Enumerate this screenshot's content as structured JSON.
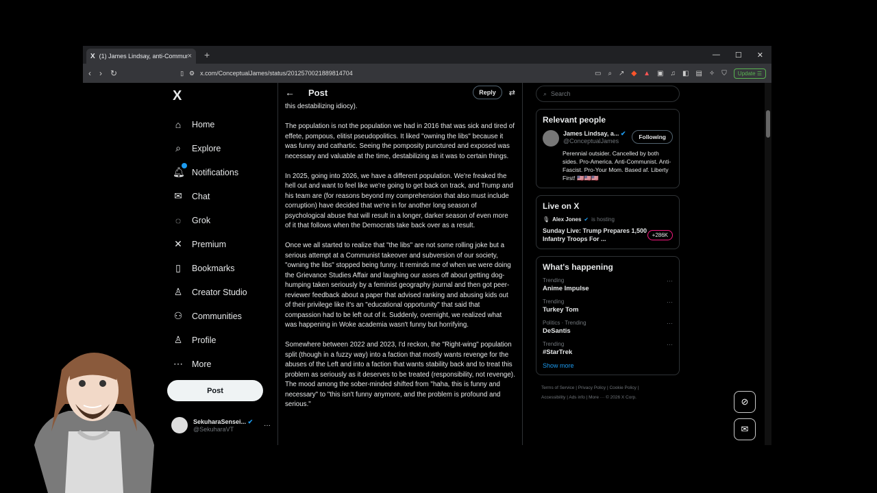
{
  "browser": {
    "tab_title": "(1) James Lindsay, anti-Commun",
    "url": "x.com/ConceptualJames/status/2012570021889814704",
    "update_label": "Update"
  },
  "nav": {
    "logo": "X",
    "items": [
      {
        "label": "Home",
        "icon": "⌂"
      },
      {
        "label": "Explore",
        "icon": "⌕"
      },
      {
        "label": "Notifications",
        "icon": "♫"
      },
      {
        "label": "Chat",
        "icon": "✉"
      },
      {
        "label": "Grok",
        "icon": "◌"
      },
      {
        "label": "Premium",
        "icon": "✕"
      },
      {
        "label": "Bookmarks",
        "icon": "▯"
      },
      {
        "label": "Creator Studio",
        "icon": "♙"
      },
      {
        "label": "Communities",
        "icon": "⚇"
      },
      {
        "label": "Profile",
        "icon": "♙"
      },
      {
        "label": "More",
        "icon": "⋯"
      }
    ],
    "post_label": "Post"
  },
  "account": {
    "name": "SekuharaSensei...",
    "handle": "@SekuharaVT"
  },
  "header": {
    "title": "Post",
    "reply_label": "Reply"
  },
  "post": {
    "paragraphs": [
      "this destabilizing idiocy).",
      "The population is not the population we had in 2016 that was sick and tired of effete, pompous, elitist pseudopolitics. It liked \"owning the libs\" because it was funny and cathartic. Seeing the pomposity punctured and exposed was necessary and valuable at the time, destabilizing as it was to certain things.",
      "In 2025, going into 2026, we have a different population. We're freaked the hell out and want to feel like we're going to get back on track, and Trump and his team are (for reasons beyond my comprehension that also must include corruption) have decided that we're in for another long season of psychological abuse that will result in a longer, darker season of even more of it that follows when the Democrats take back over as a result.",
      "Once we all started to realize that \"the libs\" are not some rolling joke but a serious attempt at a Communist takeover and subversion of our society, \"owning the libs\" stopped being funny. It reminds me of when we were doing the Grievance Studies Affair and laughing our asses off about getting dog-humping taken seriously by a feminist geography journal and then got peer-reviewer feedback about a paper that advised ranking and abusing kids out of their privilege like it's an \"educational opportunity\" that said that compassion had to be left out of it. Suddenly, overnight, we realized what was happening in Woke academia wasn't funny but horrifying.",
      "Somewhere between 2022 and 2023, I'd reckon, the \"Right-wing\" population split (though in a fuzzy way) into a faction that mostly wants revenge for the abuses of the Left and into a faction that wants stability back and to treat this problem as seriously as it deserves to be treated (responsibility, not revenge). The mood among the sober-minded shifted from \"haha, this is funny and necessary\" to \"this isn't funny anymore, and the problem is profound and serious.\""
    ]
  },
  "right": {
    "search_placeholder": "Search",
    "relevant_title": "Relevant people",
    "person": {
      "name": "James Lindsay, a...",
      "handle": "@ConceptualJames",
      "follow_label": "Following",
      "bio": "Perennial outsider. Cancelled by both sides. Pro-America. Anti-Communist. Anti-Fascist. Pro-Your Mom. Based af. Liberty First! 🇺🇸🇺🇸🇺🇸"
    },
    "live_title": "Live on X",
    "live": {
      "host": "Alex Jones",
      "hosting_text": "is hosting",
      "title": "Sunday Live: Trump Prepares 1,500 Infantry Troops For ...",
      "count": "+286K"
    },
    "happening_title": "What's happening",
    "trends": [
      {
        "meta": "Trending",
        "name": "Anime Impulse"
      },
      {
        "meta": "Trending",
        "name": "Turkey Tom"
      },
      {
        "meta": "Politics · Trending",
        "name": "DeSantis"
      },
      {
        "meta": "Trending",
        "name": "#StarTrek"
      }
    ],
    "show_more": "Show more",
    "footer_line1": "Terms of Service  |  Privacy Policy  |  Cookie Policy  |",
    "footer_line2": "Accessibility  |  Ads info  |  More ···  © 2026 X Corp."
  }
}
